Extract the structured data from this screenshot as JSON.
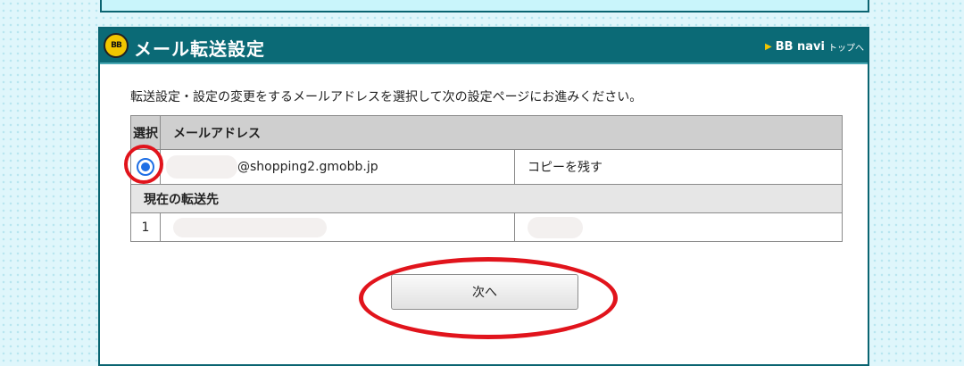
{
  "header": {
    "title": "メール転送設定",
    "logo": "BB",
    "navi_bb": "BB navi",
    "navi_suffix": "トップへ"
  },
  "instruction": "転送設定・設定の変更をするメールアドレスを選択して次の設定ページにお進みください。",
  "table": {
    "col_select": "選択",
    "col_address": "メールアドレス",
    "address_domain": "@shopping2.gmobb.jp",
    "copy_option": "コピーを残す",
    "forward_header": "現在の転送先",
    "forward_rows": [
      {
        "no": "1"
      }
    ]
  },
  "next_button": "次へ",
  "colors": {
    "header_bg": "#0b6a76",
    "annotation_red": "#e1141c",
    "radio_blue": "#1f6fe5"
  }
}
